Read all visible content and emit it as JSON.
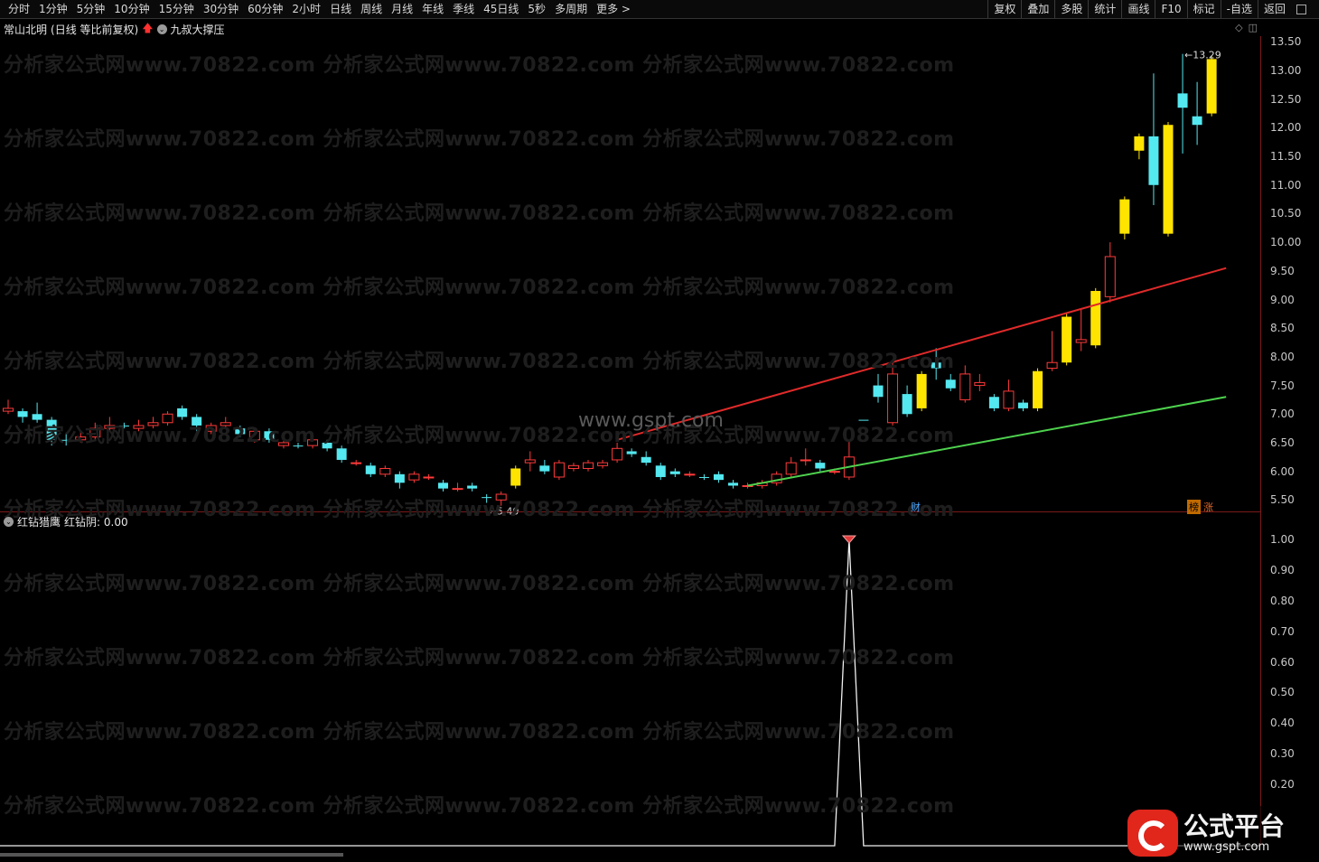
{
  "toolbar": {
    "periods": [
      "分时",
      "1分钟",
      "5分钟",
      "10分钟",
      "15分钟",
      "30分钟",
      "60分钟",
      "2小时",
      "日线",
      "周线",
      "月线",
      "年线",
      "季线",
      "45日线",
      "5秒",
      "多周期",
      "更多 >"
    ],
    "actions": [
      "复权",
      "叠加",
      "多股",
      "统计",
      "画线",
      "F10",
      "标记",
      "-自选",
      "返回"
    ]
  },
  "stock": {
    "name": "常山北明",
    "mode": "(日线 等比前复权)",
    "indicator": "九叔大撑压"
  },
  "main_axis": [
    "13.50",
    "13.00",
    "12.50",
    "12.00",
    "11.50",
    "11.00",
    "10.50",
    "10.00",
    "9.50",
    "9.00",
    "8.50",
    "8.00",
    "7.50",
    "7.00",
    "6.50",
    "6.00",
    "5.50"
  ],
  "annotations": {
    "high": "13.29",
    "low": "5.40",
    "cai": "财",
    "bang": "榜",
    "zhang": "涨"
  },
  "watermark": "分析家公式网www.70822.com",
  "center_watermark": "www.gspt.com",
  "indicator_panel": {
    "title": "红钻猎鹰",
    "value_label": "红钻阴: 0.00",
    "axis": [
      "1.00",
      "0.90",
      "0.80",
      "0.70",
      "0.60",
      "0.50",
      "0.40",
      "0.30",
      "0.20"
    ]
  },
  "logo": {
    "name": "公式平台",
    "url": "www.gspt.com"
  },
  "colors": {
    "up": "#ff3a3a",
    "down": "#54e8f0",
    "signal": "#ffe400",
    "resistance": "#e02a2a",
    "support": "#4ed24e",
    "axis": "#7a1a1a"
  },
  "chart_data": {
    "type": "candlestick",
    "ylim": [
      5.3,
      13.6
    ],
    "candles": [
      {
        "o": 7.1,
        "c": 7.05,
        "h": 7.25,
        "l": 7.0,
        "k": "u"
      },
      {
        "o": 7.05,
        "c": 6.95,
        "h": 7.1,
        "l": 6.85,
        "k": "d"
      },
      {
        "o": 7.0,
        "c": 6.9,
        "h": 7.2,
        "l": 6.85,
        "k": "d"
      },
      {
        "o": 6.9,
        "c": 6.55,
        "h": 6.95,
        "l": 6.45,
        "k": "d"
      },
      {
        "o": 6.55,
        "c": 6.55,
        "h": 6.65,
        "l": 6.45,
        "k": "d"
      },
      {
        "o": 6.55,
        "c": 6.6,
        "h": 6.7,
        "l": 6.5,
        "k": "u"
      },
      {
        "o": 6.6,
        "c": 6.75,
        "h": 6.85,
        "l": 6.55,
        "k": "u"
      },
      {
        "o": 6.75,
        "c": 6.8,
        "h": 6.95,
        "l": 6.7,
        "k": "u"
      },
      {
        "o": 6.8,
        "c": 6.8,
        "h": 6.85,
        "l": 6.75,
        "k": "d"
      },
      {
        "o": 6.75,
        "c": 6.8,
        "h": 6.9,
        "l": 6.7,
        "k": "u"
      },
      {
        "o": 6.8,
        "c": 6.85,
        "h": 6.95,
        "l": 6.75,
        "k": "u"
      },
      {
        "o": 6.85,
        "c": 7.0,
        "h": 7.05,
        "l": 6.8,
        "k": "u"
      },
      {
        "o": 7.1,
        "c": 6.95,
        "h": 7.15,
        "l": 6.9,
        "k": "d"
      },
      {
        "o": 6.95,
        "c": 6.8,
        "h": 7.0,
        "l": 6.7,
        "k": "d"
      },
      {
        "o": 6.7,
        "c": 6.8,
        "h": 6.85,
        "l": 6.65,
        "k": "u"
      },
      {
        "o": 6.8,
        "c": 6.85,
        "h": 6.95,
        "l": 6.75,
        "k": "u"
      },
      {
        "o": 6.75,
        "c": 6.65,
        "h": 6.8,
        "l": 6.6,
        "k": "d"
      },
      {
        "o": 6.55,
        "c": 6.7,
        "h": 6.75,
        "l": 6.5,
        "k": "u"
      },
      {
        "o": 6.7,
        "c": 6.55,
        "h": 6.75,
        "l": 6.5,
        "k": "d"
      },
      {
        "o": 6.45,
        "c": 6.5,
        "h": 6.55,
        "l": 6.4,
        "k": "u"
      },
      {
        "o": 6.45,
        "c": 6.45,
        "h": 6.5,
        "l": 6.4,
        "k": "d"
      },
      {
        "o": 6.45,
        "c": 6.55,
        "h": 6.6,
        "l": 6.4,
        "k": "u"
      },
      {
        "o": 6.5,
        "c": 6.4,
        "h": 6.55,
        "l": 6.35,
        "k": "d"
      },
      {
        "o": 6.4,
        "c": 6.2,
        "h": 6.45,
        "l": 6.15,
        "k": "d"
      },
      {
        "o": 6.15,
        "c": 6.15,
        "h": 6.2,
        "l": 6.1,
        "k": "u"
      },
      {
        "o": 6.1,
        "c": 5.95,
        "h": 6.15,
        "l": 5.9,
        "k": "d"
      },
      {
        "o": 5.95,
        "c": 6.05,
        "h": 6.1,
        "l": 5.9,
        "k": "u"
      },
      {
        "o": 5.95,
        "c": 5.8,
        "h": 6.0,
        "l": 5.7,
        "k": "d"
      },
      {
        "o": 5.85,
        "c": 5.95,
        "h": 6.0,
        "l": 5.8,
        "k": "u"
      },
      {
        "o": 5.9,
        "c": 5.9,
        "h": 5.95,
        "l": 5.85,
        "k": "u"
      },
      {
        "o": 5.8,
        "c": 5.7,
        "h": 5.85,
        "l": 5.65,
        "k": "d"
      },
      {
        "o": 5.7,
        "c": 5.7,
        "h": 5.8,
        "l": 5.65,
        "k": "u"
      },
      {
        "o": 5.75,
        "c": 5.7,
        "h": 5.8,
        "l": 5.65,
        "k": "d"
      },
      {
        "o": 5.55,
        "c": 5.55,
        "h": 5.6,
        "l": 5.45,
        "k": "d"
      },
      {
        "o": 5.5,
        "c": 5.6,
        "h": 5.65,
        "l": 5.4,
        "k": "u"
      },
      {
        "o": 5.75,
        "c": 6.05,
        "h": 6.1,
        "l": 5.7,
        "k": "y"
      },
      {
        "o": 6.2,
        "c": 6.15,
        "h": 6.35,
        "l": 6.0,
        "k": "u"
      },
      {
        "o": 6.1,
        "c": 6.0,
        "h": 6.2,
        "l": 5.95,
        "k": "d"
      },
      {
        "o": 5.9,
        "c": 6.15,
        "h": 6.2,
        "l": 5.85,
        "k": "u"
      },
      {
        "o": 6.05,
        "c": 6.1,
        "h": 6.15,
        "l": 6.0,
        "k": "u"
      },
      {
        "o": 6.05,
        "c": 6.15,
        "h": 6.2,
        "l": 6.0,
        "k": "u"
      },
      {
        "o": 6.1,
        "c": 6.15,
        "h": 6.2,
        "l": 6.05,
        "k": "u"
      },
      {
        "o": 6.2,
        "c": 6.4,
        "h": 6.5,
        "l": 6.15,
        "k": "u"
      },
      {
        "o": 6.35,
        "c": 6.3,
        "h": 6.4,
        "l": 6.25,
        "k": "d"
      },
      {
        "o": 6.25,
        "c": 6.15,
        "h": 6.35,
        "l": 6.1,
        "k": "d"
      },
      {
        "o": 6.1,
        "c": 5.9,
        "h": 6.15,
        "l": 5.85,
        "k": "d"
      },
      {
        "o": 6.0,
        "c": 5.95,
        "h": 6.05,
        "l": 5.9,
        "k": "d"
      },
      {
        "o": 5.95,
        "c": 5.95,
        "h": 6.0,
        "l": 5.9,
        "k": "u"
      },
      {
        "o": 5.9,
        "c": 5.9,
        "h": 5.95,
        "l": 5.85,
        "k": "d"
      },
      {
        "o": 5.95,
        "c": 5.85,
        "h": 6.0,
        "l": 5.8,
        "k": "d"
      },
      {
        "o": 5.8,
        "c": 5.75,
        "h": 5.85,
        "l": 5.7,
        "k": "d"
      },
      {
        "o": 5.75,
        "c": 5.75,
        "h": 5.8,
        "l": 5.7,
        "k": "u"
      },
      {
        "o": 5.75,
        "c": 5.8,
        "h": 5.85,
        "l": 5.7,
        "k": "u"
      },
      {
        "o": 5.8,
        "c": 5.95,
        "h": 6.0,
        "l": 5.75,
        "k": "u"
      },
      {
        "o": 5.95,
        "c": 6.15,
        "h": 6.25,
        "l": 5.9,
        "k": "u"
      },
      {
        "o": 6.2,
        "c": 6.2,
        "h": 6.4,
        "l": 6.1,
        "k": "u"
      },
      {
        "o": 6.15,
        "c": 6.05,
        "h": 6.2,
        "l": 6.0,
        "k": "d"
      },
      {
        "o": 6.0,
        "c": 6.0,
        "h": 6.05,
        "l": 5.95,
        "k": "u"
      },
      {
        "o": 5.9,
        "c": 6.25,
        "h": 6.55,
        "l": 5.85,
        "k": "u"
      },
      {
        "o": 6.9,
        "c": 6.9,
        "h": 6.9,
        "l": 6.9,
        "k": "d"
      },
      {
        "o": 7.5,
        "c": 7.3,
        "h": 7.7,
        "l": 7.2,
        "k": "d"
      },
      {
        "o": 6.85,
        "c": 7.7,
        "h": 7.95,
        "l": 6.8,
        "k": "u"
      },
      {
        "o": 7.35,
        "c": 7.0,
        "h": 7.5,
        "l": 6.95,
        "k": "d"
      },
      {
        "o": 7.1,
        "c": 7.7,
        "h": 7.75,
        "l": 7.05,
        "k": "y"
      },
      {
        "o": 7.9,
        "c": 7.8,
        "h": 8.15,
        "l": 7.6,
        "k": "d"
      },
      {
        "o": 7.6,
        "c": 7.45,
        "h": 7.7,
        "l": 7.4,
        "k": "d"
      },
      {
        "o": 7.25,
        "c": 7.7,
        "h": 7.85,
        "l": 7.2,
        "k": "u"
      },
      {
        "o": 7.5,
        "c": 7.55,
        "h": 7.7,
        "l": 7.4,
        "k": "u"
      },
      {
        "o": 7.3,
        "c": 7.1,
        "h": 7.35,
        "l": 7.05,
        "k": "d"
      },
      {
        "o": 7.1,
        "c": 7.4,
        "h": 7.6,
        "l": 7.05,
        "k": "u"
      },
      {
        "o": 7.2,
        "c": 7.1,
        "h": 7.25,
        "l": 7.05,
        "k": "d"
      },
      {
        "o": 7.1,
        "c": 7.75,
        "h": 7.8,
        "l": 7.05,
        "k": "y"
      },
      {
        "o": 7.8,
        "c": 7.9,
        "h": 8.45,
        "l": 7.75,
        "k": "u"
      },
      {
        "o": 7.9,
        "c": 8.7,
        "h": 8.75,
        "l": 7.85,
        "k": "y"
      },
      {
        "o": 8.25,
        "c": 8.3,
        "h": 8.85,
        "l": 8.1,
        "k": "u"
      },
      {
        "o": 8.2,
        "c": 9.15,
        "h": 9.2,
        "l": 8.15,
        "k": "y"
      },
      {
        "o": 9.05,
        "c": 9.75,
        "h": 10.0,
        "l": 8.95,
        "k": "u"
      },
      {
        "o": 10.15,
        "c": 10.75,
        "h": 10.8,
        "l": 10.05,
        "k": "y"
      },
      {
        "o": 11.6,
        "c": 11.85,
        "h": 11.9,
        "l": 11.45,
        "k": "y"
      },
      {
        "o": 11.85,
        "c": 11.0,
        "h": 12.95,
        "l": 10.65,
        "k": "d"
      },
      {
        "o": 10.15,
        "c": 12.05,
        "h": 12.1,
        "l": 10.1,
        "k": "y"
      },
      {
        "o": 12.35,
        "c": 12.6,
        "h": 13.29,
        "l": 11.55,
        "k": "d"
      },
      {
        "o": 12.2,
        "c": 12.05,
        "h": 12.8,
        "l": 11.7,
        "k": "d"
      },
      {
        "o": 12.25,
        "c": 13.2,
        "h": 13.25,
        "l": 12.2,
        "k": "y"
      }
    ],
    "resistance_line": {
      "from": [
        42,
        6.55
      ],
      "to": [
        84,
        9.55
      ]
    },
    "support_line": {
      "from": [
        51,
        5.75
      ],
      "to": [
        84,
        7.3
      ]
    },
    "indicator_series": {
      "name": "红钻阴",
      "signal_index": 58,
      "values_peak": 1.0,
      "baseline": 0.0
    }
  }
}
